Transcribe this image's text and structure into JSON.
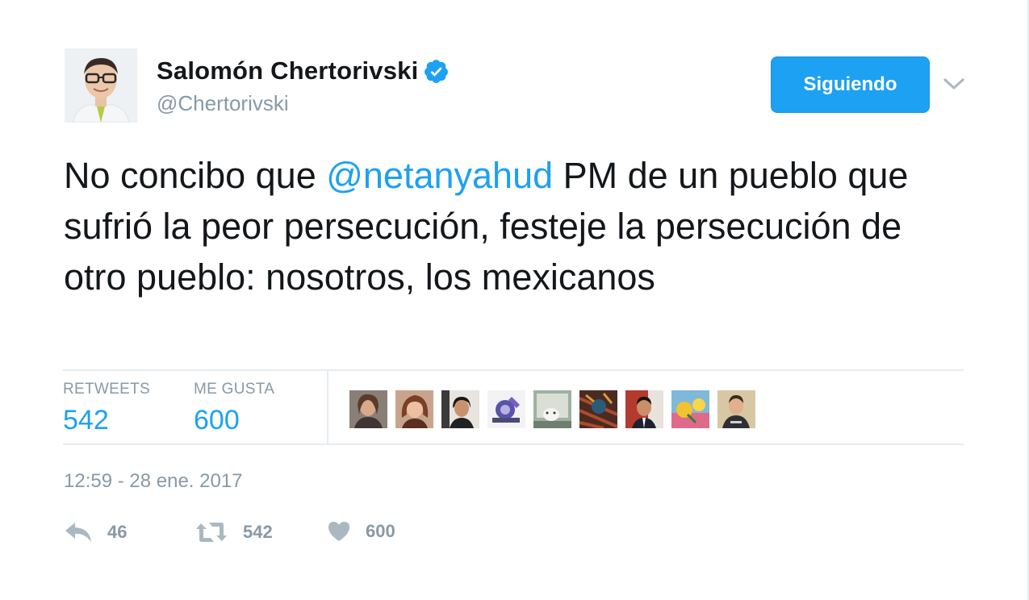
{
  "user": {
    "display_name": "Salomón Chertorivski",
    "handle": "@Chertorivski",
    "verified_icon": "verified-badge-icon"
  },
  "follow_button": {
    "label": "Siguiendo"
  },
  "tweet": {
    "text_before_mention": "No concibo que ",
    "mention": "@netanyahud",
    "text_after_mention": " PM de un pueblo que sufrió la peor persecución, festeje la persecución de otro pueblo: nosotros, los mexicanos"
  },
  "stats": {
    "retweets_label": "RETWEETS",
    "retweets_value": "542",
    "likes_label": "ME GUSTA",
    "likes_value": "600"
  },
  "timestamp": "12:59 - 28 ene. 2017",
  "actions": {
    "reply_count": "46",
    "retweet_count": "542",
    "like_count": "600"
  },
  "colors": {
    "accent": "#1da1f2",
    "text": "#14171a",
    "muted": "#8899a6",
    "divider": "#e6ecf0"
  }
}
